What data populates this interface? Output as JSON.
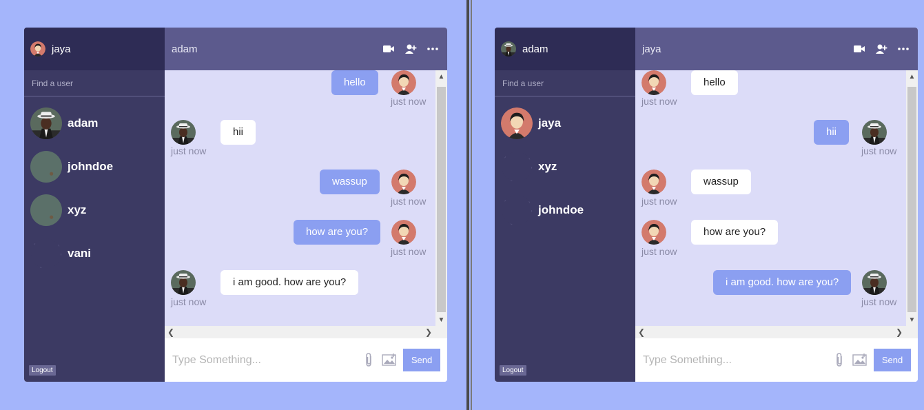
{
  "windows": [
    {
      "me": {
        "name": "jaya",
        "avatar": "female-avatar"
      },
      "search_placeholder": "Find a user",
      "users": [
        {
          "name": "adam",
          "avatar": "male-hat-avatar"
        },
        {
          "name": "johndoe",
          "avatar": "blurry-photo-avatar"
        },
        {
          "name": "xyz",
          "avatar": "blurry-photo-avatar"
        },
        {
          "name": "vani",
          "avatar": "empty-avatar"
        }
      ],
      "logout_label": "Logout",
      "chat_title": "adam",
      "messages": [
        {
          "text": "hello",
          "time": "just now",
          "direction": "out"
        },
        {
          "text": "hii",
          "time": "just now",
          "direction": "in"
        },
        {
          "text": "wassup",
          "time": "just now",
          "direction": "out"
        },
        {
          "text": "how are you?",
          "time": "just now",
          "direction": "out"
        },
        {
          "text": "i am good. how are you?",
          "time": "just now",
          "direction": "in"
        }
      ],
      "composer_placeholder": "Type Something...",
      "send_label": "Send"
    },
    {
      "me": {
        "name": "adam",
        "avatar": "male-hat-avatar"
      },
      "search_placeholder": "Find a user",
      "users": [
        {
          "name": "jaya",
          "avatar": "female-avatar"
        },
        {
          "name": "xyz",
          "avatar": "empty-avatar"
        },
        {
          "name": "johndoe",
          "avatar": "empty-avatar"
        }
      ],
      "logout_label": "Logout",
      "chat_title": "jaya",
      "messages": [
        {
          "text": "hello",
          "time": "just now",
          "direction": "in"
        },
        {
          "text": "hii",
          "time": "just now",
          "direction": "out"
        },
        {
          "text": "wassup",
          "time": "just now",
          "direction": "in"
        },
        {
          "text": "how are you?",
          "time": "just now",
          "direction": "in"
        },
        {
          "text": "i am good. how are you?",
          "time": "just now",
          "direction": "out"
        }
      ],
      "composer_placeholder": "Type Something...",
      "send_label": "Send"
    }
  ],
  "icons": {
    "header": [
      "video-camera-icon",
      "add-user-icon",
      "more-options-icon"
    ],
    "composer": [
      "paperclip-icon",
      "image-icon"
    ]
  },
  "colors": {
    "page_bg": "#a4b5fb",
    "sidebar_bg": "#3c3a63",
    "header_bg": "#5c5a8d",
    "messages_bg": "#dcdcf8",
    "accent": "#8b9ff1"
  }
}
